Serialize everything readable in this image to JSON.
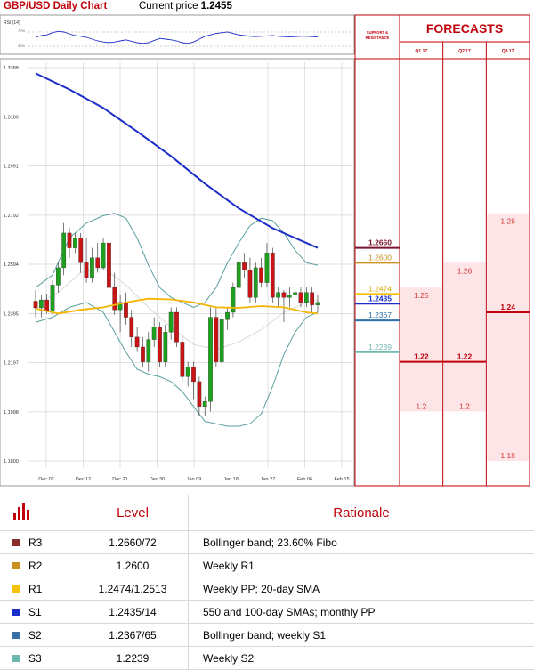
{
  "header": {
    "title": "GBP/USD Daily Chart",
    "price_label": "Current price",
    "price_value": "1.2455"
  },
  "rsi": {
    "label": "RSI (14)",
    "upper": "70%",
    "lower": "30%"
  },
  "chart_data": {
    "type": "line",
    "y_ticks": [
      "1.3388",
      "1.3189",
      "1.2991",
      "1.2792",
      "1.2594",
      "1.2395",
      "1.2197",
      "1.1998",
      "1.1800"
    ],
    "ylim": [
      1.18,
      1.3388
    ],
    "x_ticks": [
      "Dec 02",
      "Dec 12",
      "Dec 21",
      "Dec 30",
      "Jan 09",
      "Jan 18",
      "Jan 27",
      "Feb 06",
      "Feb 15"
    ],
    "colors": {
      "ma_long": "#1a2dc8",
      "ma_short": "#f5b400",
      "bollinger": "#5a9fa0",
      "bull": "#1ea01e",
      "bear": "#c81414",
      "accent": "#c0000a"
    },
    "ohlc": [
      [
        1.2445,
        1.249,
        1.238,
        1.2418
      ],
      [
        1.2418,
        1.247,
        1.238,
        1.245
      ],
      [
        1.245,
        1.2475,
        1.2395,
        1.2405
      ],
      [
        1.2405,
        1.253,
        1.239,
        1.251
      ],
      [
        1.251,
        1.26,
        1.248,
        1.258
      ],
      [
        1.258,
        1.276,
        1.255,
        1.272
      ],
      [
        1.272,
        1.274,
        1.262,
        1.266
      ],
      [
        1.266,
        1.272,
        1.264,
        1.27
      ],
      [
        1.27,
        1.272,
        1.256,
        1.26
      ],
      [
        1.26,
        1.27,
        1.252,
        1.254
      ],
      [
        1.254,
        1.266,
        1.252,
        1.262
      ],
      [
        1.262,
        1.268,
        1.256,
        1.258
      ],
      [
        1.258,
        1.27,
        1.257,
        1.268
      ],
      [
        1.268,
        1.27,
        1.248,
        1.25
      ],
      [
        1.25,
        1.256,
        1.239,
        1.241
      ],
      [
        1.241,
        1.247,
        1.232,
        1.244
      ],
      [
        1.244,
        1.248,
        1.235,
        1.238
      ],
      [
        1.238,
        1.241,
        1.226,
        1.23
      ],
      [
        1.23,
        1.234,
        1.224,
        1.226
      ],
      [
        1.226,
        1.23,
        1.218,
        1.22
      ],
      [
        1.22,
        1.232,
        1.216,
        1.229
      ],
      [
        1.229,
        1.238,
        1.226,
        1.234
      ],
      [
        1.234,
        1.236,
        1.218,
        1.22
      ],
      [
        1.22,
        1.235,
        1.218,
        1.232
      ],
      [
        1.232,
        1.242,
        1.229,
        1.24
      ],
      [
        1.24,
        1.242,
        1.226,
        1.228
      ],
      [
        1.228,
        1.231,
        1.212,
        1.214
      ],
      [
        1.214,
        1.22,
        1.21,
        1.218
      ],
      [
        1.218,
        1.22,
        1.205,
        1.212
      ],
      [
        1.212,
        1.214,
        1.198,
        1.202
      ],
      [
        1.202,
        1.206,
        1.198,
        1.204
      ],
      [
        1.204,
        1.242,
        1.2,
        1.238
      ],
      [
        1.238,
        1.242,
        1.218,
        1.22
      ],
      [
        1.22,
        1.239,
        1.218,
        1.237
      ],
      [
        1.237,
        1.242,
        1.233,
        1.24
      ],
      [
        1.24,
        1.252,
        1.238,
        1.25
      ],
      [
        1.25,
        1.262,
        1.247,
        1.26
      ],
      [
        1.26,
        1.264,
        1.254,
        1.257
      ],
      [
        1.257,
        1.262,
        1.244,
        1.246
      ],
      [
        1.246,
        1.26,
        1.244,
        1.258
      ],
      [
        1.258,
        1.262,
        1.25,
        1.252
      ],
      [
        1.252,
        1.268,
        1.25,
        1.264
      ],
      [
        1.264,
        1.266,
        1.244,
        1.246
      ],
      [
        1.246,
        1.25,
        1.242,
        1.248
      ],
      [
        1.248,
        1.249,
        1.236,
        1.246
      ],
      [
        1.246,
        1.25,
        1.242,
        1.247
      ],
      [
        1.247,
        1.251,
        1.243,
        1.248
      ],
      [
        1.248,
        1.25,
        1.242,
        1.244
      ],
      [
        1.244,
        1.25,
        1.242,
        1.248
      ],
      [
        1.248,
        1.25,
        1.24,
        1.243
      ],
      [
        1.243,
        1.247,
        1.24,
        1.244
      ]
    ],
    "ma_long": [
      [
        0,
        1.3365
      ],
      [
        6,
        1.33
      ],
      [
        12,
        1.3225
      ],
      [
        18,
        1.313
      ],
      [
        24,
        1.303
      ],
      [
        30,
        1.292
      ],
      [
        36,
        1.282
      ],
      [
        42,
        1.274
      ],
      [
        46,
        1.27
      ],
      [
        50,
        1.266
      ]
    ],
    "ma_short": [
      [
        0,
        1.2415
      ],
      [
        4,
        1.2395
      ],
      [
        8,
        1.241
      ],
      [
        12,
        1.242
      ],
      [
        16,
        1.244
      ],
      [
        20,
        1.2455
      ],
      [
        24,
        1.2452
      ],
      [
        28,
        1.244
      ],
      [
        32,
        1.242
      ],
      [
        36,
        1.2418
      ],
      [
        40,
        1.2425
      ],
      [
        44,
        1.242
      ],
      [
        48,
        1.24
      ],
      [
        50,
        1.2395
      ]
    ],
    "boll_upper": [
      [
        0,
        1.25
      ],
      [
        3,
        1.255
      ],
      [
        6,
        1.27
      ],
      [
        9,
        1.276
      ],
      [
        12,
        1.279
      ],
      [
        14,
        1.28
      ],
      [
        16,
        1.278
      ],
      [
        18,
        1.27
      ],
      [
        20,
        1.259
      ],
      [
        22,
        1.25
      ],
      [
        24,
        1.246
      ],
      [
        26,
        1.244
      ],
      [
        28,
        1.242
      ],
      [
        30,
        1.244
      ],
      [
        32,
        1.25
      ],
      [
        34,
        1.26
      ],
      [
        36,
        1.268
      ],
      [
        38,
        1.275
      ],
      [
        40,
        1.278
      ],
      [
        42,
        1.277
      ],
      [
        44,
        1.272
      ],
      [
        46,
        1.265
      ],
      [
        48,
        1.26
      ],
      [
        50,
        1.259
      ]
    ],
    "boll_lower": [
      [
        0,
        1.236
      ],
      [
        3,
        1.238
      ],
      [
        6,
        1.242
      ],
      [
        9,
        1.244
      ],
      [
        12,
        1.24
      ],
      [
        14,
        1.232
      ],
      [
        16,
        1.224
      ],
      [
        18,
        1.217
      ],
      [
        20,
        1.215
      ],
      [
        22,
        1.214
      ],
      [
        24,
        1.212
      ],
      [
        26,
        1.208
      ],
      [
        28,
        1.202
      ],
      [
        30,
        1.196
      ],
      [
        32,
        1.195
      ],
      [
        34,
        1.194
      ],
      [
        36,
        1.194
      ],
      [
        38,
        1.195
      ],
      [
        40,
        1.199
      ],
      [
        42,
        1.21
      ],
      [
        44,
        1.223
      ],
      [
        46,
        1.232
      ],
      [
        48,
        1.238
      ],
      [
        50,
        1.24
      ]
    ],
    "boll_mid": [
      [
        0,
        1.243
      ],
      [
        4,
        1.248
      ],
      [
        8,
        1.256
      ],
      [
        12,
        1.258
      ],
      [
        16,
        1.251
      ],
      [
        20,
        1.242
      ],
      [
        24,
        1.234
      ],
      [
        28,
        1.227
      ],
      [
        32,
        1.225
      ],
      [
        36,
        1.228
      ],
      [
        40,
        1.233
      ],
      [
        44,
        1.24
      ],
      [
        48,
        1.244
      ],
      [
        50,
        1.245
      ]
    ],
    "rsi_values": [
      55,
      60,
      62,
      68,
      72,
      70,
      65,
      60,
      58,
      55,
      50,
      45,
      42,
      40,
      42,
      45,
      48,
      44,
      40,
      38,
      40,
      46,
      52,
      50,
      48,
      45,
      40,
      38,
      42,
      50,
      58,
      62,
      66,
      68,
      70,
      66,
      62,
      60,
      58,
      57,
      58,
      59,
      60,
      58,
      57,
      56,
      57,
      58,
      58,
      57,
      56
    ]
  },
  "support_resistance": {
    "heading": [
      "SUPPORT &",
      "RESISTANCE"
    ],
    "levels": [
      {
        "label": "1.2660",
        "value": 1.266,
        "color": "#7a1430",
        "bold": true
      },
      {
        "label": "1.2600",
        "value": 1.26,
        "color": "#c8901e",
        "bold": false
      },
      {
        "label": "1.2474",
        "value": 1.2474,
        "color": "#f5c000",
        "bold": false
      },
      {
        "label": "1.2435",
        "value": 1.2435,
        "color": "#1a2dc8",
        "bold": true
      },
      {
        "label": "1.2367",
        "value": 1.2367,
        "color": "#2a6fa6",
        "bold": false
      },
      {
        "label": "1.2239",
        "value": 1.2239,
        "color": "#6fb8b0",
        "bold": false
      }
    ]
  },
  "forecasts": {
    "title": "FORECASTS",
    "quarters": [
      {
        "label": "Q1 17",
        "high": 1.25,
        "mid": 1.22,
        "low": 1.2,
        "high_label": "1.25",
        "mid_label": "1.22",
        "low_label": "1.2"
      },
      {
        "label": "Q2 17",
        "high": 1.26,
        "mid": 1.22,
        "low": 1.2,
        "high_label": "1.26",
        "mid_label": "1.22",
        "low_label": "1.2"
      },
      {
        "label": "Q3 17",
        "high": 1.28,
        "mid": 1.24,
        "low": 1.18,
        "high_label": "1.28",
        "mid_label": "1.24",
        "low_label": "1.18"
      }
    ]
  },
  "levels_table": {
    "headers": {
      "level": "Level",
      "rationale": "Rationale"
    },
    "rows": [
      {
        "label": "R3",
        "color": "#8b2c2c",
        "level": "1.2660/72",
        "rationale": "Bollinger band; 23.60% Fibo"
      },
      {
        "label": "R2",
        "color": "#c8901e",
        "level": "1.2600",
        "rationale": "Weekly R1"
      },
      {
        "label": "R1",
        "color": "#f5c000",
        "level": "1.2474/1.2513",
        "rationale": "Weekly PP; 20-day SMA"
      },
      {
        "label": "S1",
        "color": "#1a2dc8",
        "level": "1.2435/14",
        "rationale": "550 and 100-day SMAs; monthly PP"
      },
      {
        "label": "S2",
        "color": "#3a6fa6",
        "level": "1.2367/65",
        "rationale": "Bollinger band; weekly S1"
      },
      {
        "label": "S3",
        "color": "#6fb8b0",
        "level": "1.2239",
        "rationale": "Weekly S2"
      }
    ]
  }
}
